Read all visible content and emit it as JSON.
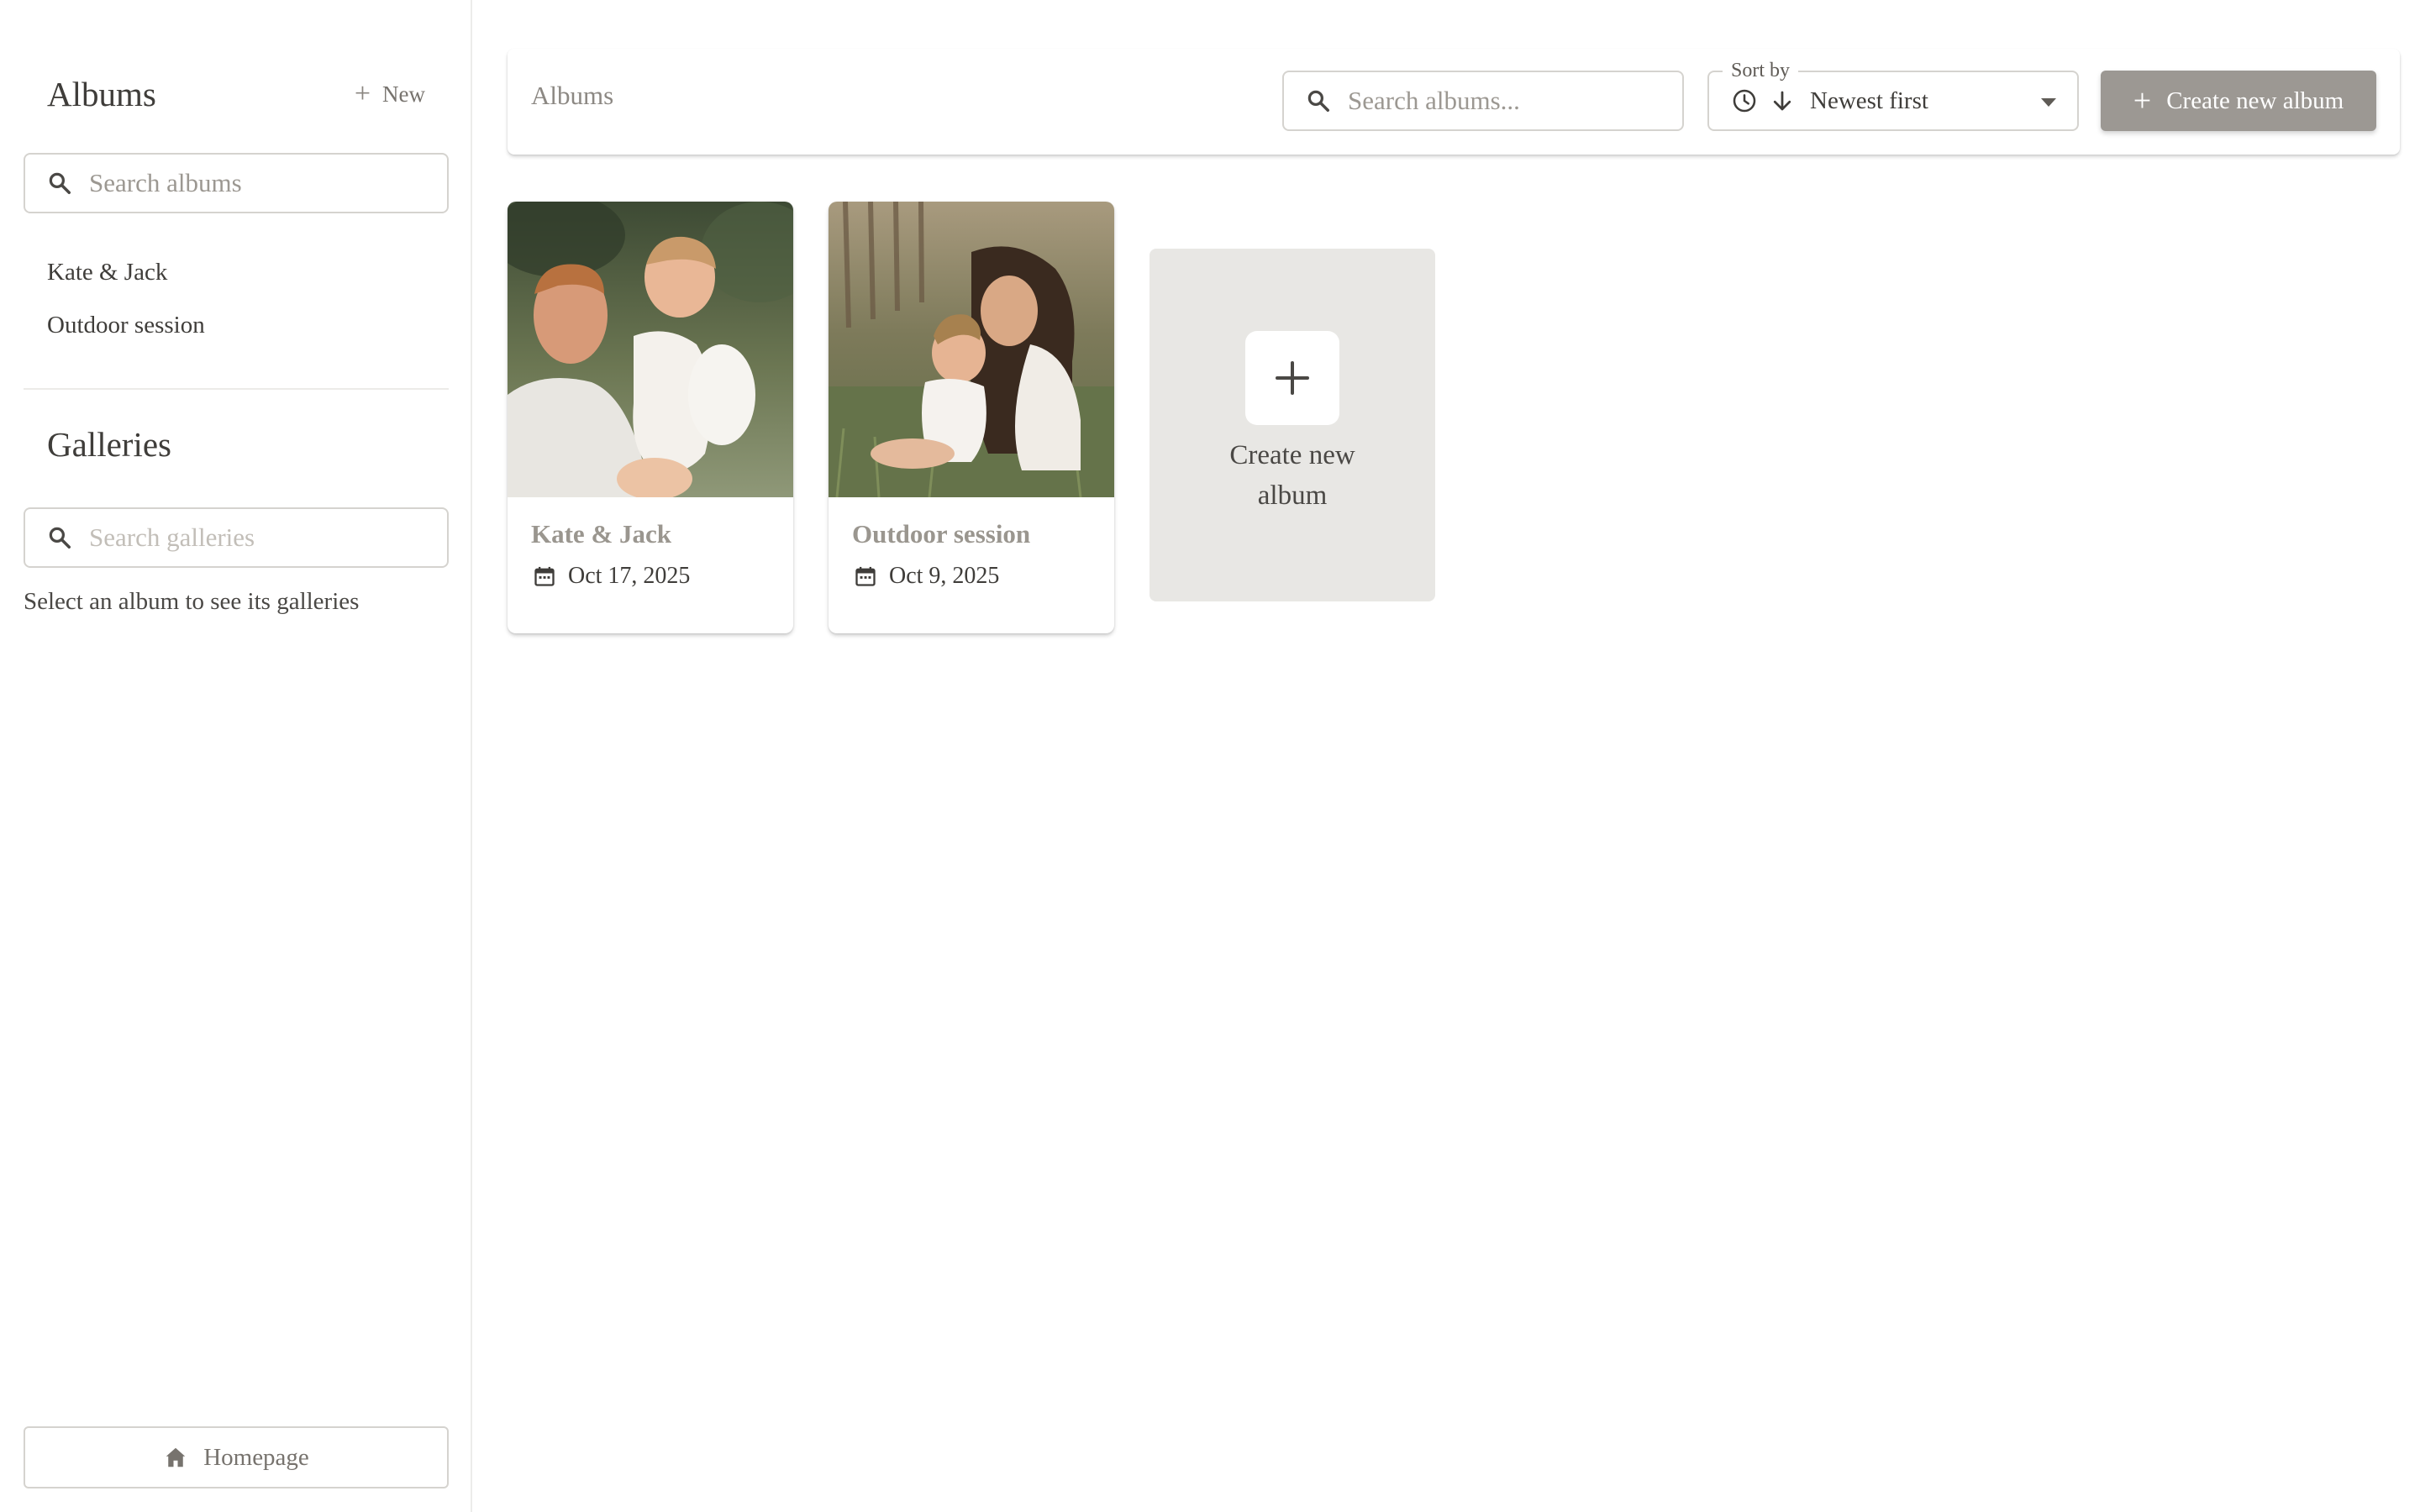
{
  "sidebar": {
    "albums_title": "Albums",
    "new_label": "New",
    "albums_search_placeholder": "Search albums",
    "albums": [
      {
        "label": "Kate & Jack"
      },
      {
        "label": "Outdoor session"
      }
    ],
    "galleries_title": "Galleries",
    "galleries_search_placeholder": "Search galleries",
    "galleries_hint": "Select an album to see its galleries",
    "home_label": "Homepage"
  },
  "topbar": {
    "title": "Albums",
    "search_placeholder": "Search albums...",
    "sort_label": "Sort by",
    "sort_value": "Newest first",
    "create_label": "Create new album"
  },
  "cards": [
    {
      "title": "Kate & Jack",
      "date": "Oct 17, 2025",
      "icon": "calendar-icon"
    },
    {
      "title": "Outdoor session",
      "date": "Oct 9, 2025",
      "icon": "calendar-icon"
    }
  ],
  "new_card": {
    "label_line1": "Create new",
    "label_line2": "album"
  },
  "colors": {
    "accent_button": "#9c9893",
    "card_title": "#9a968f",
    "placeholder_card": "#e8e7e4",
    "border": "#d5d3cf"
  },
  "icons": {
    "search": "search-icon",
    "plus": "plus-icon",
    "clock": "clock-icon",
    "sort_direction": "arrow-down-icon",
    "caret": "caret-down-icon",
    "home": "home-icon",
    "calendar": "calendar-icon"
  }
}
